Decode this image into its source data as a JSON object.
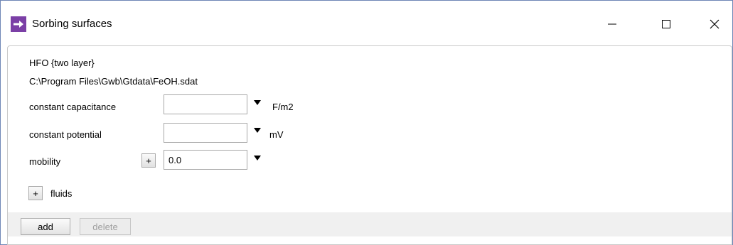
{
  "window": {
    "title": "Sorbing surfaces",
    "icon": "arrow-right-icon",
    "accent": "#7b3fa6"
  },
  "surface": {
    "name": "HFO {two layer}",
    "path": "C:\\Program Files\\Gwb\\Gtdata\\FeOH.sdat"
  },
  "fields": {
    "capacitance": {
      "label": "constant capacitance",
      "value": "",
      "unit": "F/m2"
    },
    "potential": {
      "label": "constant potential",
      "value": "",
      "unit": "mV"
    },
    "mobility": {
      "label": "mobility",
      "value": "0.0",
      "expand": "+"
    }
  },
  "fluids": {
    "expand": "+",
    "label": "fluids"
  },
  "buttons": {
    "add": "add",
    "delete": "delete"
  }
}
